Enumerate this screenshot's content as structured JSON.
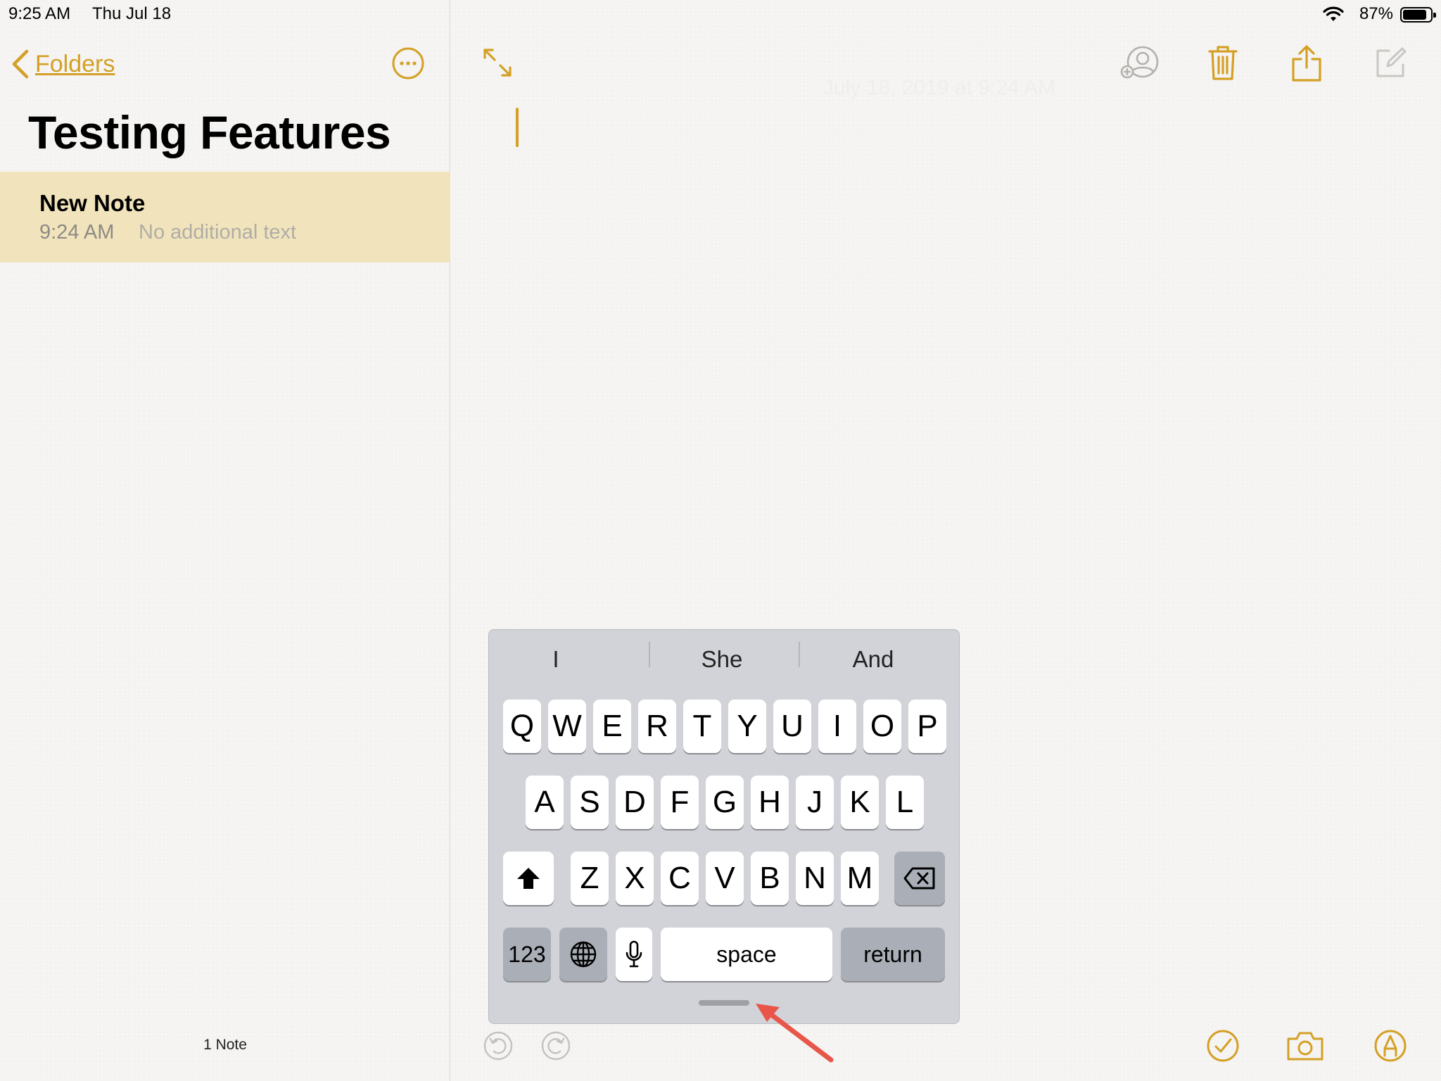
{
  "status_bar": {
    "time": "9:25 AM",
    "date": "Thu Jul 18",
    "battery_percent": "87%",
    "battery_level": 0.87
  },
  "sidebar": {
    "back_label": "Folders",
    "folder_title": "Testing Features",
    "notes": [
      {
        "title": "New Note",
        "time": "9:24 AM",
        "preview": "No additional text"
      }
    ],
    "note_count": "1 Note"
  },
  "editor": {
    "faint_date": "July 18, 2019 at 9:24 AM"
  },
  "keyboard": {
    "suggestions": [
      "I",
      "She",
      "And"
    ],
    "row1": [
      "Q",
      "W",
      "E",
      "R",
      "T",
      "Y",
      "U",
      "I",
      "O",
      "P"
    ],
    "row2": [
      "A",
      "S",
      "D",
      "F",
      "G",
      "H",
      "J",
      "K",
      "L"
    ],
    "row3": [
      "Z",
      "X",
      "C",
      "V",
      "B",
      "N",
      "M"
    ],
    "numbers_label": "123",
    "space_label": "space",
    "return_label": "return"
  },
  "colors": {
    "accent": "#d4a026",
    "selected_row": "#f1e4bc",
    "keyboard_bg": "#d1d3d9",
    "annotation_arrow": "#e8564a"
  }
}
